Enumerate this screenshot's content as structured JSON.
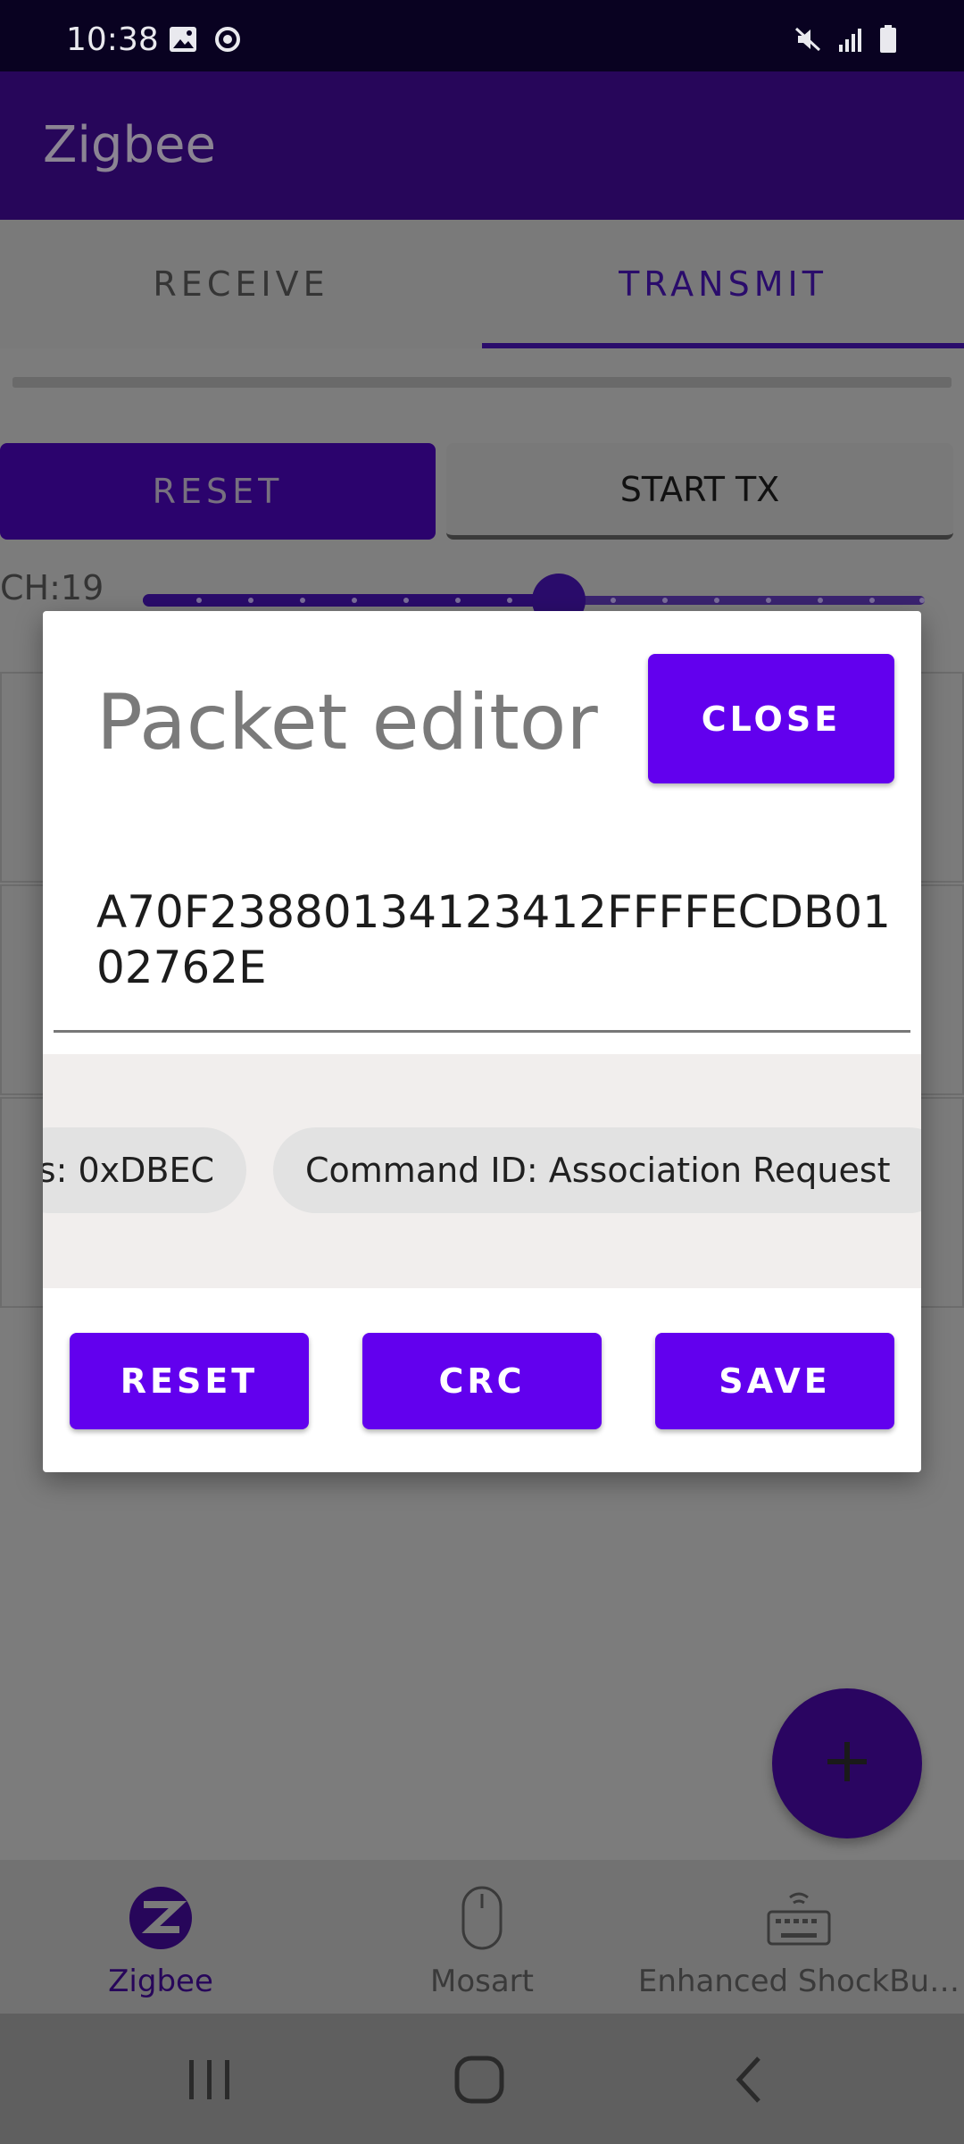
{
  "status_bar": {
    "time": "10:38",
    "left_icons": [
      "image-icon",
      "sync-icon"
    ],
    "right_icons": [
      "mute-icon",
      "signal-icon",
      "battery-icon"
    ]
  },
  "app_bar": {
    "title": "Zigbee"
  },
  "tabs": [
    {
      "label": "RECEIVE",
      "selected": false
    },
    {
      "label": "TRANSMIT",
      "selected": true
    }
  ],
  "controls": {
    "reset_label": "RESET",
    "start_tx_label": "START TX",
    "channel_label": "CH:19"
  },
  "dialog": {
    "title": "Packet editor",
    "close_label": "CLOSE",
    "packet_hex": "A70F23880134123412FFFFECDB0102762E",
    "chips": [
      {
        "label": "s: 0xDBEC"
      },
      {
        "label": "Command ID: Association Request"
      }
    ],
    "buttons": {
      "reset": "RESET",
      "crc": "CRC",
      "save": "SAVE"
    }
  },
  "fab": {
    "icon": "plus-icon"
  },
  "bottom_nav": [
    {
      "label": "Zigbee",
      "icon": "zigbee-icon",
      "selected": true
    },
    {
      "label": "Mosart",
      "icon": "mouse-icon",
      "selected": false
    },
    {
      "label": "Enhanced ShockBu…",
      "icon": "keyboard-icon",
      "selected": false
    }
  ],
  "colors": {
    "primary": "#6200ee",
    "app_bar_dimmed": "#27065a",
    "scrim": "#7c7c7c",
    "chip_area": "#f1eeed"
  }
}
